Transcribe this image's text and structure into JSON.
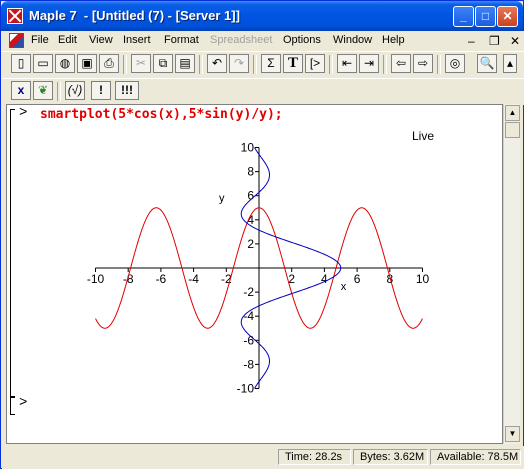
{
  "window": {
    "title": "Maple 7  - [Untitled (7) - [Server 1]]"
  },
  "menu": [
    "File",
    "Edit",
    "View",
    "Insert",
    "Format",
    "Spreadsheet",
    "Options",
    "Window",
    "Help"
  ],
  "worksheet": {
    "prompt": ">",
    "command": "smartplot(5*cos(x),5*sin(y)/y);",
    "live_label": "Live",
    "empty_prompt": ">"
  },
  "chart_data": {
    "type": "line",
    "title": "",
    "xlabel": "x",
    "ylabel": "y",
    "xlim": [
      -10,
      10
    ],
    "ylim": [
      -10,
      10
    ],
    "x_ticks": [
      -10,
      -8,
      -6,
      -4,
      -2,
      0,
      2,
      4,
      6,
      8,
      10
    ],
    "y_ticks": [
      -10,
      -8,
      -6,
      -4,
      -2,
      0,
      2,
      4,
      6,
      8,
      10
    ],
    "grid": false,
    "series": [
      {
        "expression": "5*cos(x)",
        "color": "#e00000",
        "param": "x",
        "range": [
          -10,
          10
        ]
      },
      {
        "expression": "5*sin(y)/y",
        "color": "#0000c0",
        "param": "y",
        "range": [
          -10,
          10
        ]
      }
    ]
  },
  "status": {
    "time": "Time:  28.2s",
    "bytes": "Bytes: 3.62M",
    "available": "Available: 78.5M"
  },
  "colors": {
    "titlebar": "#0054e3",
    "command": "#e00000",
    "curve1": "#e00000",
    "curve2": "#0000c0"
  }
}
